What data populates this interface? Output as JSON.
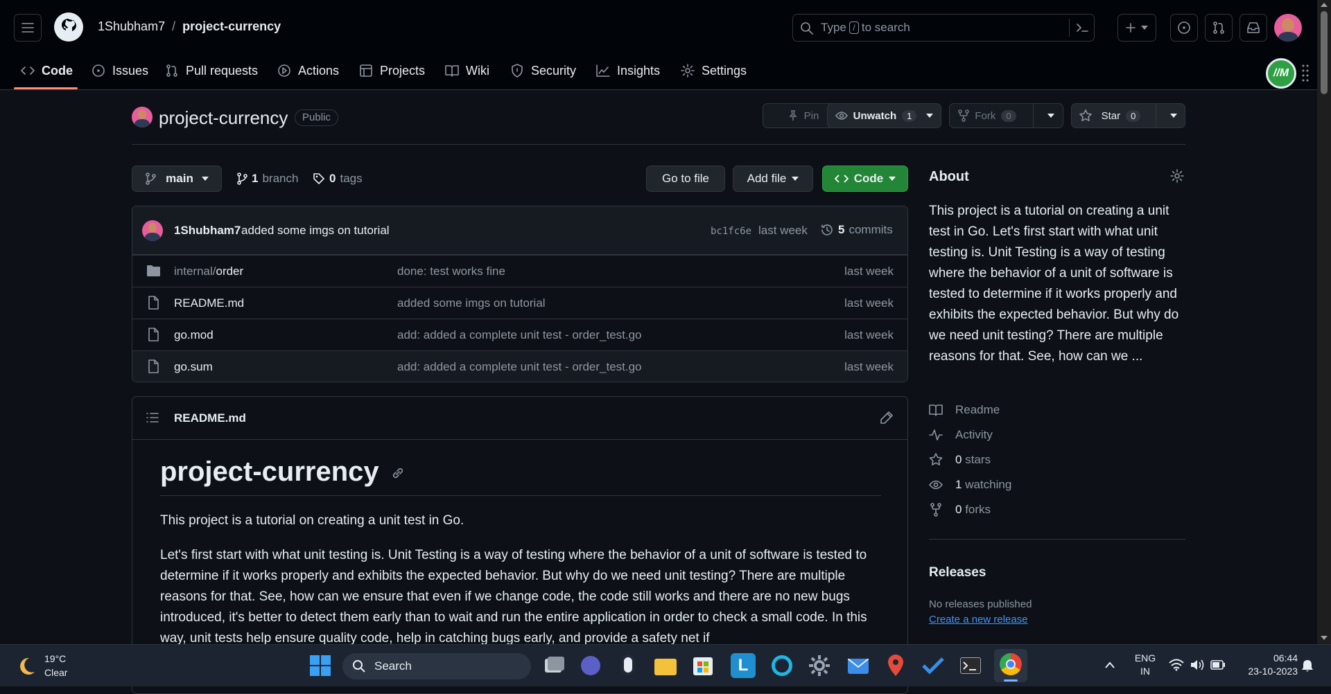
{
  "header": {
    "owner": "1Shubham7",
    "separator": "/",
    "repo": "project-currency",
    "search_prefix": "Type",
    "search_key": "/",
    "search_suffix": "to search"
  },
  "nav_tabs": [
    {
      "label": "Code"
    },
    {
      "label": "Issues"
    },
    {
      "label": "Pull requests"
    },
    {
      "label": "Actions"
    },
    {
      "label": "Projects"
    },
    {
      "label": "Wiki"
    },
    {
      "label": "Security"
    },
    {
      "label": "Insights"
    },
    {
      "label": "Settings"
    }
  ],
  "repo_head": {
    "name": "project-currency",
    "visibility": "Public",
    "pin": "Pin",
    "unwatch": "Unwatch",
    "watch_count": "1",
    "fork": "Fork",
    "fork_count": "0",
    "star": "Star",
    "star_count": "0"
  },
  "toolbar": {
    "branch": "main",
    "branch_count": "1",
    "branch_label": "branch",
    "tag_count": "0",
    "tag_label": "tags",
    "go_to_file": "Go to file",
    "add_file": "Add file",
    "code": "Code"
  },
  "commit": {
    "author": "1Shubham7",
    "message": "added some imgs on tutorial",
    "sha": "bc1fc6e",
    "time": "last week",
    "count": "5",
    "count_label": "commits"
  },
  "files": [
    {
      "dir": "internal/",
      "name": "order",
      "message": "done: test works fine",
      "time": "last week"
    },
    {
      "dir": "",
      "name": "README.md",
      "message": "added some imgs on tutorial",
      "time": "last week"
    },
    {
      "dir": "",
      "name": "go.mod",
      "message": "add: added a complete unit test - order_test.go",
      "time": "last week"
    },
    {
      "dir": "",
      "name": "go.sum",
      "message": "add: added a complete unit test - order_test.go",
      "time": "last week"
    }
  ],
  "readme": {
    "filename": "README.md",
    "title": "project-currency",
    "p1": "This project is a tutorial on creating a unit test in Go.",
    "p2": "Let's first start with what unit testing is. Unit Testing is a way of testing where the behavior of a unit of software is tested to determine if it works properly and exhibits the expected behavior. But why do we need unit testing? There are multiple reasons for that. See, how can we ensure that even if we change code, the code still works and there are no new bugs introduced, it's better to detect them early than to wait and run the entire application in order to check a small code. In this way, unit tests help ensure quality code, help in catching bugs early, and provide a safety net if"
  },
  "about": {
    "heading": "About",
    "description": "This project is a tutorial on creating a unit test in Go. Let's first start with what unit testing is. Unit Testing is a way of testing where the behavior of a unit of software is tested to determine if it works properly and exhibits the expected behavior. But why do we need unit testing? There are multiple reasons for that. See, how can we ...",
    "readme": "Readme",
    "activity": "Activity",
    "stars_count": "0",
    "stars_label": "stars",
    "watching_count": "1",
    "watching_label": "watching",
    "forks_count": "0",
    "forks_label": "forks",
    "releases_heading": "Releases",
    "no_releases": "No releases published",
    "create_release": "Create a new release"
  },
  "taskbar": {
    "temp": "19°C",
    "weather": "Clear",
    "search": "Search",
    "lang1": "ENG",
    "lang2": "IN",
    "time": "06:44",
    "date": "23-10-2023"
  },
  "colors": {
    "accent_green": "#238636",
    "link_blue": "#4493f8",
    "tab_underline": "#fd8c73"
  }
}
